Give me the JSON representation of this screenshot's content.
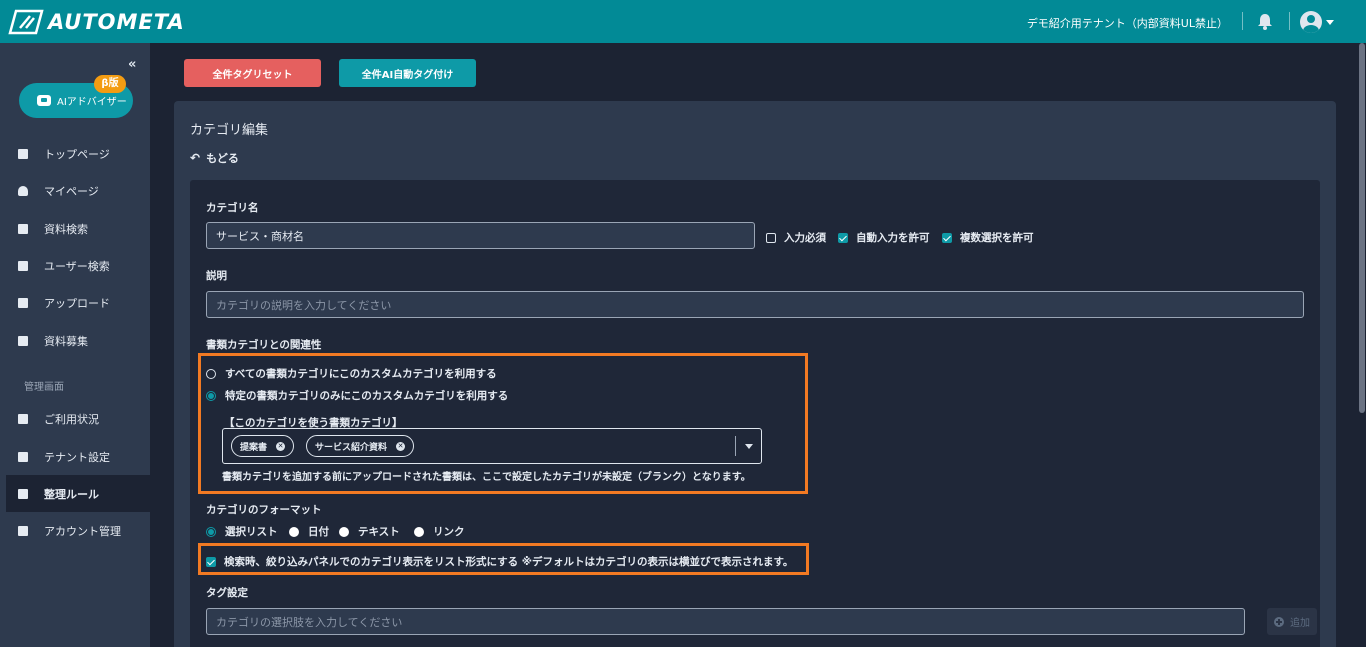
{
  "header": {
    "logo_text": "AUTOMETA",
    "tenant": "デモ紹介用テナント（内部資料UL禁止）"
  },
  "sidebar": {
    "ai_advisor": "AIアドバイザー",
    "beta_badge": "β版",
    "items": [
      {
        "label": "トップページ"
      },
      {
        "label": "マイページ"
      },
      {
        "label": "資料検索"
      },
      {
        "label": "ユーザー検索"
      },
      {
        "label": "アップロード"
      },
      {
        "label": "資料募集"
      }
    ],
    "admin_section": "管理画面",
    "admin_items": [
      {
        "label": "ご利用状況"
      },
      {
        "label": "テナント設定"
      },
      {
        "label": "整理ルール"
      },
      {
        "label": "アカウント管理"
      }
    ]
  },
  "toolbar": {
    "reset_label": "全件タグリセット",
    "ai_tag_label": "全件AI自動タグ付け"
  },
  "panel": {
    "title": "カテゴリ編集",
    "back_label": "もどる"
  },
  "form": {
    "name_label": "カテゴリ名",
    "name_value": "サービス・商材名",
    "required_label": "入力必須",
    "required_checked": false,
    "auto_input_label": "自動入力を許可",
    "auto_input_checked": true,
    "multi_select_label": "複数選択を許可",
    "multi_select_checked": true,
    "desc_label": "説明",
    "desc_placeholder": "カテゴリの説明を入力してください",
    "relation_label": "書類カテゴリとの関連性",
    "relation_option_all": "すべての書類カテゴリにこのカスタムカテゴリを利用する",
    "relation_option_specific": "特定の書類カテゴリのみにこのカスタムカテゴリを利用する",
    "relation_selected": "specific",
    "doc_category_label": "【このカテゴリを使う書類カテゴリ】",
    "doc_categories": [
      "提案書",
      "サービス紹介資料"
    ],
    "doc_category_note": "書類カテゴリを追加する前にアップロードされた書類は、ここで設定したカテゴリが未設定（ブランク）となります。",
    "format_label": "カテゴリのフォーマット",
    "format_options": [
      "選択リスト",
      "日付",
      "テキスト",
      "リンク"
    ],
    "format_selected": "選択リスト",
    "list_display_label": "検索時、絞り込みパネルでのカテゴリ表示をリスト形式にする ※デフォルトはカテゴリの表示は横並びで表示されます。",
    "list_display_checked": true,
    "tag_label": "タグ設定",
    "tag_placeholder": "カテゴリの選択肢を入力してください",
    "add_label": "追加"
  },
  "colors": {
    "topbar": "#028a96",
    "accent": "#0e9aa7",
    "reset_button": "#e5605f",
    "highlight": "#f27a23",
    "beta_badge": "#f39c12"
  }
}
